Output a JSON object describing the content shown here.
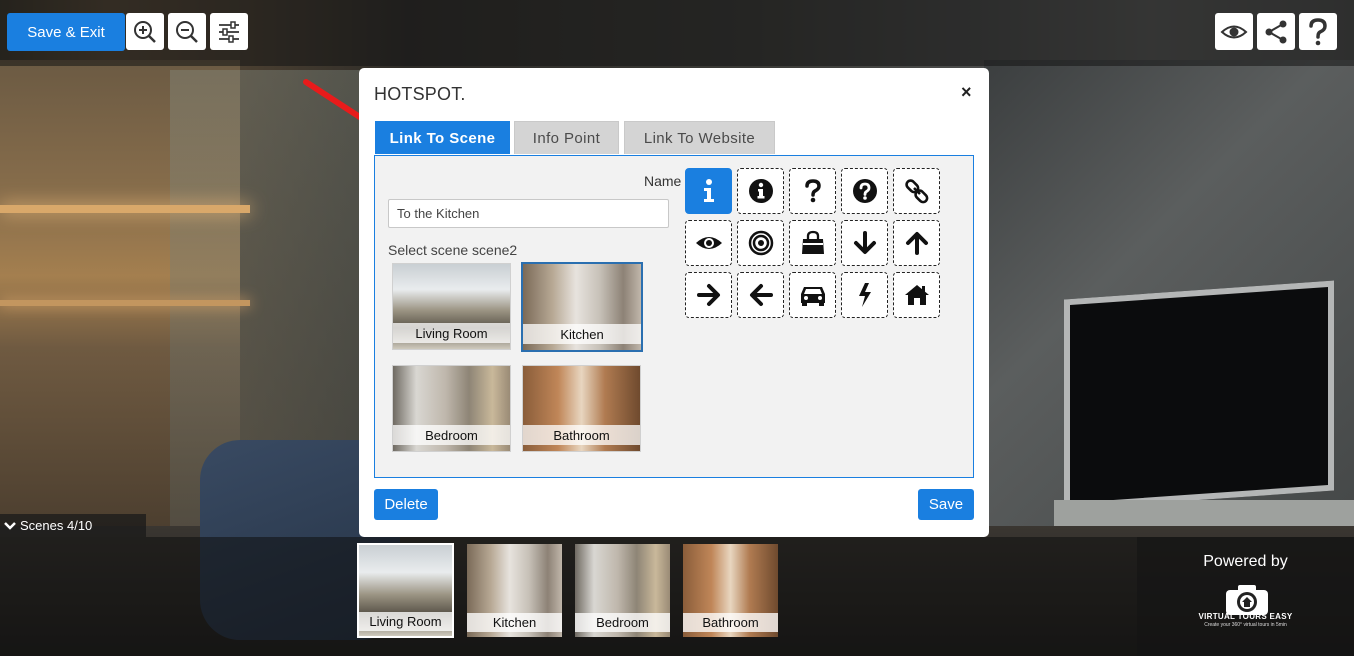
{
  "toolbar": {
    "save_exit_label": "Save & Exit",
    "zoom_in_icon": "zoom-in-icon",
    "zoom_out_icon": "zoom-out-icon",
    "settings_icon": "sliders-icon",
    "preview_icon": "eye-icon",
    "share_icon": "share-icon",
    "help_icon": "question-icon"
  },
  "modal": {
    "title": "HOTSPOT.",
    "close_glyph": "×",
    "tabs": [
      {
        "label": "Link To Scene",
        "active": true
      },
      {
        "label": "Info Point",
        "active": false
      },
      {
        "label": "Link To Website",
        "active": false
      }
    ],
    "name_label": "Name",
    "name_value": "To the Kitchen",
    "select_label": "Select scene scene2",
    "scenes": [
      {
        "label": "Living Room",
        "selected": false
      },
      {
        "label": "Kitchen",
        "selected": true
      },
      {
        "label": "Bedroom",
        "selected": false
      },
      {
        "label": "Bathroom",
        "selected": false
      }
    ],
    "icons": [
      "info-icon",
      "info-circle-icon",
      "question-icon",
      "question-circle-icon",
      "link-icon",
      "eye-icon",
      "target-icon",
      "shopping-bag-icon",
      "arrow-down-icon",
      "arrow-up-icon",
      "arrow-right-icon",
      "arrow-left-icon",
      "car-icon",
      "bolt-icon",
      "home-icon"
    ],
    "active_icon": "info-icon",
    "delete_label": "Delete",
    "save_label": "Save"
  },
  "scenes_bar": {
    "toggle_label": "Scenes 4/10",
    "items": [
      {
        "label": "Living Room",
        "current": true
      },
      {
        "label": "Kitchen",
        "current": false
      },
      {
        "label": "Bedroom",
        "current": false
      },
      {
        "label": "Bathroom",
        "current": false
      }
    ]
  },
  "branding": {
    "powered_by": "Powered by",
    "brand": "VIRTUAL TOURS EASY",
    "tagline": "Create your 360° virtual tours in 5min"
  },
  "colors": {
    "accent": "#1a7fe0",
    "arrow_annotation": "#e81b1b"
  }
}
